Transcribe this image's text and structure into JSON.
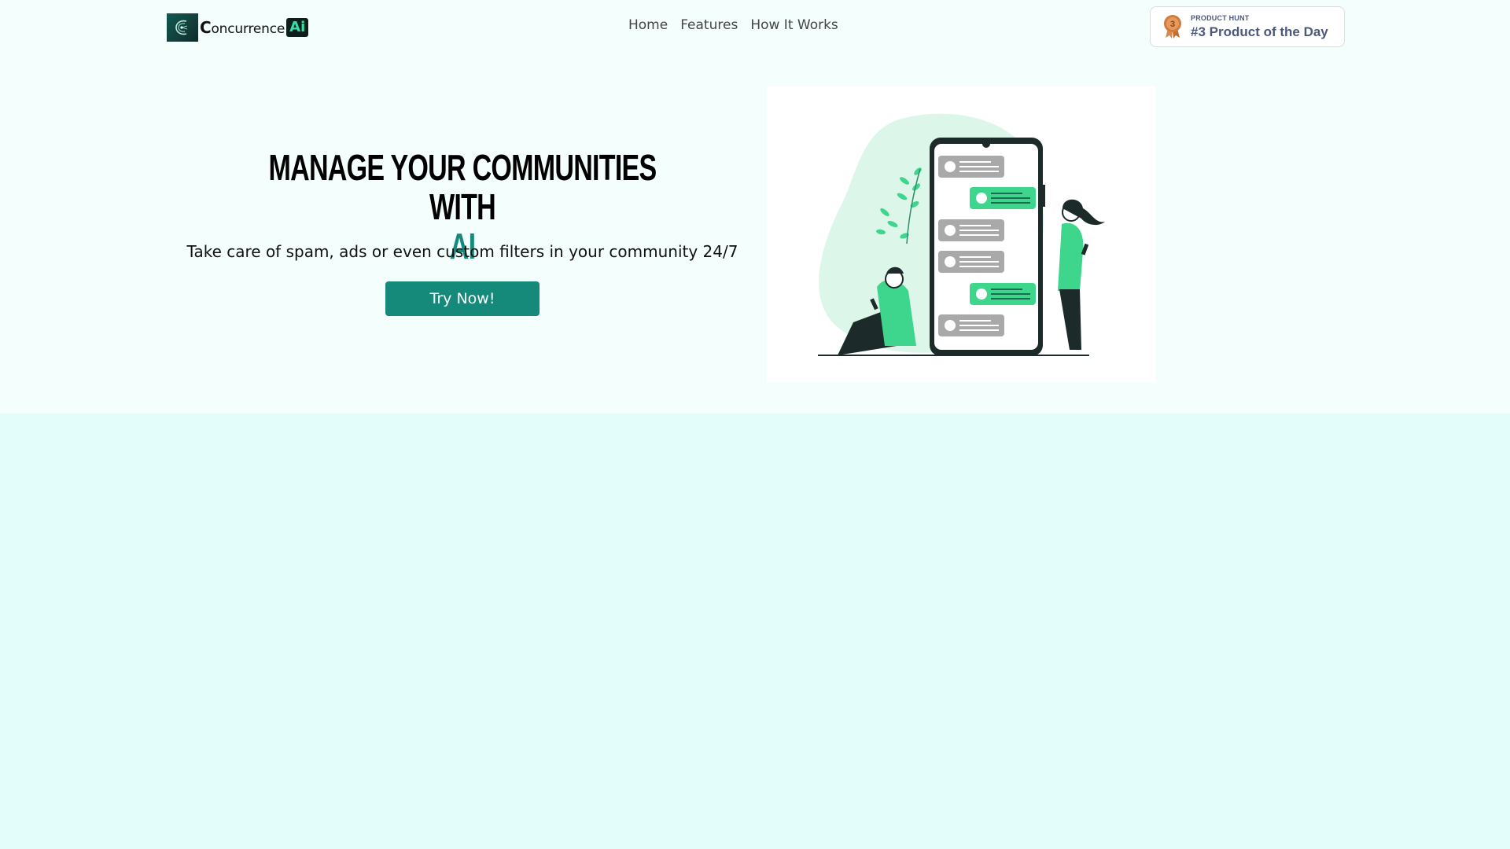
{
  "header": {
    "logo": {
      "letter": "C",
      "text": "oncurrence",
      "badge": "Ai"
    },
    "nav": [
      "Home",
      "Features",
      "How It Works"
    ],
    "product_hunt": {
      "label": "PRODUCT HUNT",
      "title": "#3 Product of the Day",
      "rank": "3"
    }
  },
  "hero": {
    "title": "MANAGE YOUR COMMUNITIES WITH",
    "title_accent": "AI",
    "subtitle": "Take care of spam, ads or even custom filters in your community 24/7",
    "cta": "Try Now!"
  },
  "colors": {
    "accent": "#158a7b",
    "chat_green": "#3dd68c",
    "page_bg": "#e2fdfa",
    "hero_bg": "#f4fffd"
  }
}
